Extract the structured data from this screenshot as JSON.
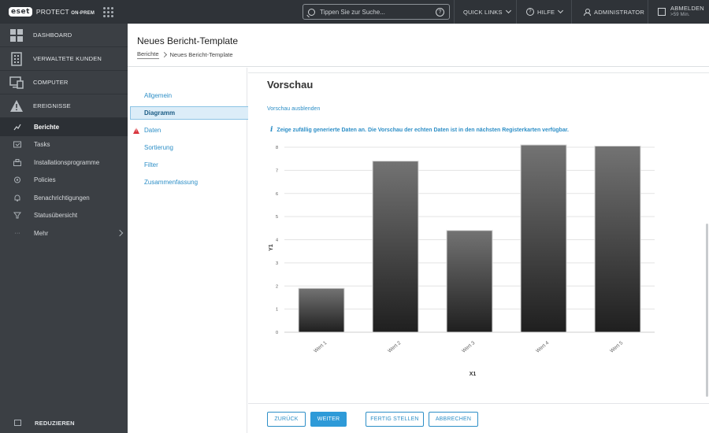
{
  "topbar": {
    "logo_text": "eset",
    "product_name": "PROTECT",
    "product_suffix": "ON-PREM",
    "search_placeholder": "Tippen Sie zur Suche...",
    "quick_links": "QUICK LINKS",
    "help": "HILFE",
    "user": "ADMINISTRATOR",
    "logout": "ABMELDEN",
    "session_time": ">59 Min."
  },
  "sidebar": {
    "main_items": [
      {
        "label": "DASHBOARD",
        "icon": "dashboard-icon"
      },
      {
        "label": "VERWALTETE KUNDEN",
        "icon": "building-icon"
      },
      {
        "label": "COMPUTER",
        "icon": "monitor-icon"
      },
      {
        "label": "EREIGNISSE",
        "icon": "warning-icon"
      }
    ],
    "sub_items": [
      {
        "label": "Berichte",
        "icon": "reports-icon",
        "active": true
      },
      {
        "label": "Tasks",
        "icon": "tasks-icon"
      },
      {
        "label": "Installationsprogramme",
        "icon": "installer-icon"
      },
      {
        "label": "Policies",
        "icon": "policies-icon"
      },
      {
        "label": "Benachrichtigungen",
        "icon": "notifications-icon"
      },
      {
        "label": "Statusübersicht",
        "icon": "status-icon"
      },
      {
        "label": "Mehr",
        "icon": "more-icon"
      }
    ],
    "reduce": "REDUZIEREN"
  },
  "header": {
    "title": "Neues Bericht-Template",
    "breadcrumb": [
      "Berichte",
      "Neues Bericht-Template"
    ]
  },
  "steps": [
    {
      "label": "Allgemein",
      "state": "normal"
    },
    {
      "label": "Diagramm",
      "state": "active"
    },
    {
      "label": "Daten",
      "state": "warning"
    },
    {
      "label": "Sortierung",
      "state": "normal"
    },
    {
      "label": "Filter",
      "state": "normal"
    },
    {
      "label": "Zusammenfassung",
      "state": "normal"
    }
  ],
  "preview": {
    "title": "Vorschau",
    "hide_link": "Vorschau ausblenden",
    "info": "Zeige zufällig generierte Daten an. Die Vorschau der echten Daten ist in den nächsten Registerkarten verfügbar."
  },
  "chart_data": {
    "type": "bar",
    "categories": [
      "Wert 1",
      "Wert 2",
      "Wert 3",
      "Wert 4",
      "Wert 5"
    ],
    "values": [
      1.9,
      7.4,
      4.4,
      8.1,
      8.05
    ],
    "xlabel": "X1",
    "ylabel": "Y1",
    "ylim": [
      0,
      8
    ],
    "yticks": [
      0,
      1,
      2,
      3,
      4,
      5,
      6,
      7,
      8
    ],
    "grid": true
  },
  "footer": {
    "back": "ZURÜCK",
    "next": "WEITER",
    "finish": "FERTIG STELLEN",
    "cancel": "ABBRECHEN"
  }
}
